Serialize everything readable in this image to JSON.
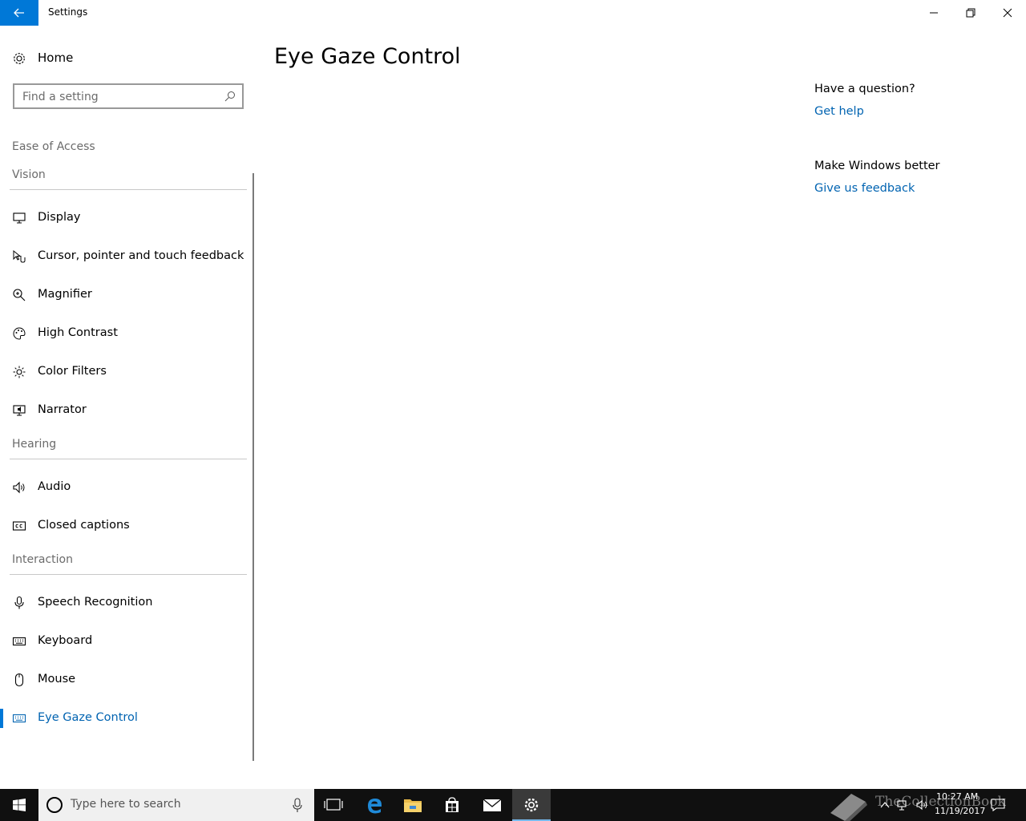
{
  "titlebar": {
    "title": "Settings",
    "back_icon": "arrow-left-icon",
    "minimize_icon": "minimize-icon",
    "maximize_icon": "restore-icon",
    "close_icon": "close-icon",
    "accent": "#0078d7"
  },
  "sidebar": {
    "home_label": "Home",
    "search_placeholder": "Find a setting",
    "section_title": "Ease of Access",
    "groups": {
      "vision": "Vision",
      "hearing": "Hearing",
      "interaction": "Interaction"
    },
    "items": [
      {
        "label": "Display",
        "icon": "monitor-icon"
      },
      {
        "label": "Cursor, pointer and touch feedback",
        "icon": "cursor-touch-icon"
      },
      {
        "label": "Magnifier",
        "icon": "magnifier-icon"
      },
      {
        "label": "High Contrast",
        "icon": "palette-icon"
      },
      {
        "label": "Color Filters",
        "icon": "sun-icon"
      },
      {
        "label": "Narrator",
        "icon": "narrator-icon"
      },
      {
        "label": "Audio",
        "icon": "speaker-icon"
      },
      {
        "label": "Closed captions",
        "icon": "cc-icon"
      },
      {
        "label": "Speech Recognition",
        "icon": "microphone-icon"
      },
      {
        "label": "Keyboard",
        "icon": "keyboard-icon"
      },
      {
        "label": "Mouse",
        "icon": "mouse-icon"
      },
      {
        "label": "Eye Gaze Control",
        "icon": "eye-gaze-keyboard-icon",
        "active": true
      }
    ]
  },
  "main": {
    "title": "Eye Gaze Control",
    "help": {
      "question": "Have a question?",
      "link": "Get help"
    },
    "feedback": {
      "question": "Make Windows better",
      "link": "Give us feedback"
    }
  },
  "taskbar": {
    "search_placeholder": "Type here to search",
    "watermark": "TheCollectionBook",
    "time": "10:27 AM",
    "date": "11/19/2017"
  }
}
